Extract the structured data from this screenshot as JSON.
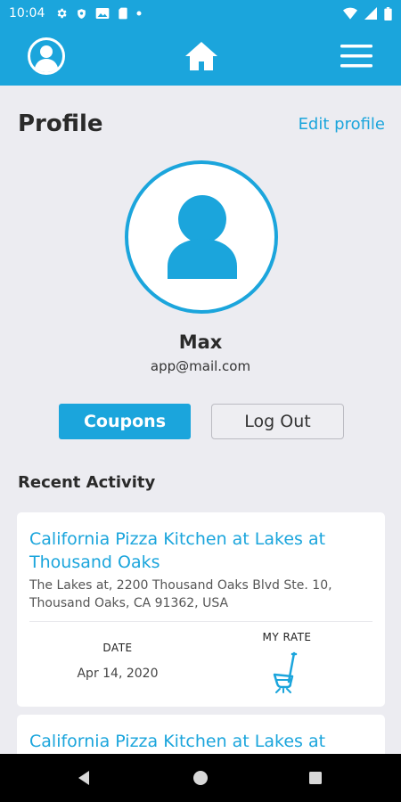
{
  "status_bar": {
    "time": "10:04",
    "left_icons": [
      "settings-icon",
      "shield-icon",
      "image-icon",
      "sim-card-icon",
      "dot-icon"
    ],
    "right_icons": [
      "wifi-icon",
      "cellular-signal-icon",
      "battery-icon"
    ]
  },
  "app_bar": {
    "color": "#1BA5DC",
    "icons": [
      "profile-icon",
      "home-icon",
      "menu-icon"
    ]
  },
  "profile": {
    "title": "Profile",
    "edit_label": "Edit profile",
    "name": "Max",
    "email": "app@mail.com"
  },
  "actions": {
    "coupons_label": "Coupons",
    "logout_label": "Log Out"
  },
  "recent": {
    "title": "Recent Activity",
    "items": [
      {
        "name": "California Pizza Kitchen at Lakes at Thousand Oaks",
        "address": "The Lakes at, 2200 Thousand Oaks Blvd Ste. 10, Thousand Oaks, CA 91362, USA",
        "date_label": "DATE",
        "date": "Apr 14, 2020",
        "rate_label": "MY RATE",
        "rate_icon": "shovel-icon"
      },
      {
        "name": "California Pizza Kitchen at Lakes at"
      }
    ]
  },
  "nav_bar": {
    "icons": [
      "back-icon",
      "home-circle-icon",
      "recents-square-icon"
    ]
  },
  "colors": {
    "accent": "#1BA5DC",
    "background": "#ECECF1",
    "text_dark": "#2A2A2A"
  }
}
